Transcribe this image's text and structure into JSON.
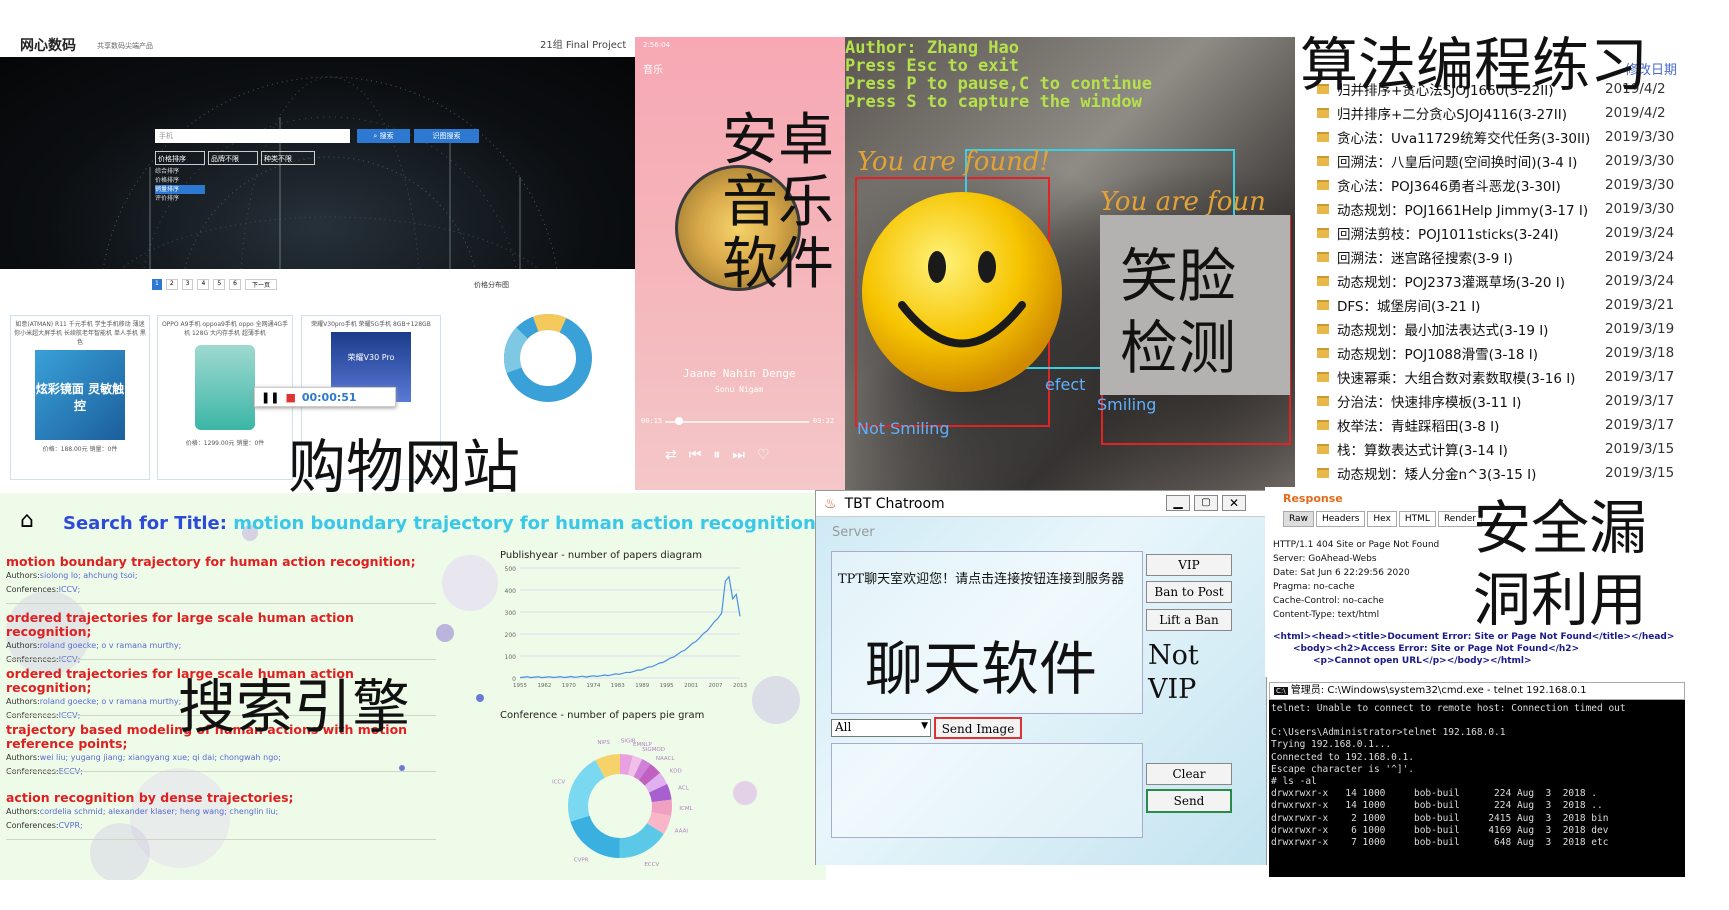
{
  "overlays": {
    "shop": "购物网站",
    "music": [
      "安卓",
      "音乐",
      "软件"
    ],
    "face": [
      "笑脸",
      "检测"
    ],
    "algo": "算法编程练习",
    "search": "搜索引擎",
    "chat": "聊天软件",
    "vuln": [
      "安全漏",
      "洞利用"
    ]
  },
  "shop": {
    "brand": "网心数码",
    "slogan": "共享数码尖端产品",
    "project": "21组 Final Project",
    "search_placeholder": "手机",
    "search_btn": "搜索",
    "voice_btn": "识图搜索",
    "filters": [
      "价格排序",
      "品牌不限",
      "种类不限"
    ],
    "sort_options": [
      "综合排序",
      "价格排序",
      "销量排序",
      "评价排序"
    ],
    "pages": [
      "1",
      "2",
      "3",
      "4",
      "5",
      "6",
      "下一页"
    ],
    "chart_label": "价格分布图",
    "timer": "00:00:51",
    "products": [
      {
        "desc": "如意(ATMAN) R11 千元手机 学生手机移动 薄迷你小米超大屏手机 长续航老年智能机 单人手机 黑色",
        "img": "炫彩镜面 灵敏触控",
        "price": "价格：188.00元  销量：0件"
      },
      {
        "desc": "OPPO A9手机 oppoa9手机 oppo 全网通4G手机 128G 大内存手机 超薄手机",
        "img": "",
        "price": "价格：1299.00元  销量：0件"
      },
      {
        "desc": "荣耀V30pro手机 荣耀5G手机 8GB+128GB",
        "img": "荣耀V30 Pro",
        "price": ""
      }
    ]
  },
  "music": {
    "status_time": "2:56:04",
    "title_label": "音乐",
    "song": "Jaane Nahin Denge",
    "artist": "Sonu Nigam",
    "t_now": "00:15",
    "t_end": "03:22"
  },
  "face": {
    "author": "Author: Zhang Hao",
    "help1": "Press Esc to exit",
    "help2": "Press P to pause,C to continue",
    "help3": "Press S to capture the window",
    "found1": "You are found!",
    "found2": "You are foun",
    "not_smiling": "Not Smiling",
    "smiling": "Smiling",
    "detected": "efect"
  },
  "algo": {
    "header_date": "修改日期",
    "rows": [
      {
        "name": "归并排序+贪心法SJOJ1660(3-22II)",
        "date": "2019/4/2"
      },
      {
        "name": "归并排序+二分贪心SJOJ4116(3-27II)",
        "date": "2019/4/2"
      },
      {
        "name": "贪心法：Uva11729统筹交代任务(3-30II)",
        "date": "2019/3/30"
      },
      {
        "name": "回溯法：八皇后问题(空间换时间)(3-4 I)",
        "date": "2019/3/30"
      },
      {
        "name": "贪心法：POJ3646勇者斗恶龙(3-30I)",
        "date": "2019/3/30"
      },
      {
        "name": "动态规划：POJ1661Help Jimmy(3-17 I)",
        "date": "2019/3/30"
      },
      {
        "name": "回溯法剪枝：POJ1011sticks(3-24I)",
        "date": "2019/3/24"
      },
      {
        "name": "回溯法：迷宫路径搜索(3-9 I)",
        "date": "2019/3/24"
      },
      {
        "name": "动态规划：POJ2373灌溉草场(3-20 I)",
        "date": "2019/3/24"
      },
      {
        "name": "DFS：城堡房间(3-21 I)",
        "date": "2019/3/21"
      },
      {
        "name": "动态规划：最小加法表达式(3-19 I)",
        "date": "2019/3/19"
      },
      {
        "name": "动态规划：POJ1088滑雪(3-18 I)",
        "date": "2019/3/18"
      },
      {
        "name": "快速幂乘：大组合数对素数取模(3-16 I)",
        "date": "2019/3/17"
      },
      {
        "name": "分治法：快速排序模板(3-11 I)",
        "date": "2019/3/17"
      },
      {
        "name": "枚举法：青蛙踩稻田(3-8 I)",
        "date": "2019/3/17"
      },
      {
        "name": "栈：算数表达式计算(3-14 I)",
        "date": "2019/3/15"
      },
      {
        "name": "动态规划：矮人分金n^3(3-15 I)",
        "date": "2019/3/15"
      }
    ]
  },
  "search": {
    "prefix": "Search for Title: ",
    "query": "motion boundary trajectory for human action recognition",
    "results": [
      {
        "title": "motion boundary trajectory for human action recognition;",
        "authors": "siolong lo; ahchung tsoi;",
        "conf": "ICCV;"
      },
      {
        "title": "ordered trajectories for large scale human action recognition;",
        "authors": "roland goecke; o v ramana murthy;",
        "conf": "ICCV;"
      },
      {
        "title": "ordered trajectories for large scale human action recognition;",
        "authors": "roland goecke; o v ramana murthy;",
        "conf": "ICCV;"
      },
      {
        "title": "trajectory based modeling of human actions with motion reference points;",
        "authors": "wei liu; yugang jiang; xiangyang xue; qi dai; chongwah ngo;",
        "conf": "ECCV;"
      },
      {
        "title": "action recognition by dense trajectories;",
        "authors": "cordelia schmid; alexander klaser; heng wang; chenglin liu;",
        "conf": "CVPR;"
      }
    ],
    "authors_label": "Authors:",
    "conf_label": "Conferences:",
    "chart1_title": "Publishyear - number of papers diagram",
    "chart2_title": "Conference - number of papers pie gram",
    "chart1_yticks": [
      "500",
      "400",
      "300",
      "200",
      "100",
      "0"
    ],
    "chart1_xticks": [
      "1955",
      "1962",
      "1970",
      "1974",
      "1983",
      "1989",
      "1995",
      "2001",
      "2007",
      "2013"
    ],
    "pie_labels": [
      "SIGIR",
      "EMNLP",
      "SIGMOD",
      "NAACL",
      "KDD",
      "ACL",
      "ICML",
      "AAAI",
      "ECCV",
      "CVPR",
      "ICCV",
      "NIPS"
    ]
  },
  "chat": {
    "title": "TBT Chatroom",
    "server_label": "Server",
    "welcome": "TPT聊天室欢迎您！请点击连接按钮连接到服务器",
    "buttons": [
      "VIP",
      "Ban to Post",
      "Lift a Ban"
    ],
    "status": [
      "Not",
      "VIP"
    ],
    "select_value": "All",
    "send_image": "Send Image",
    "clear": "Clear",
    "send": "Send"
  },
  "vuln": {
    "response_label": "Response",
    "tabs": [
      "Raw",
      "Headers",
      "Hex",
      "HTML",
      "Render"
    ],
    "http_lines": [
      "HTTP/1.1 404 Site or Page Not Found",
      "Server: GoAhead-Webs",
      "Date: Sat Jun  6 22:29:56 2020",
      "Pragma: no-cache",
      "Cache-Control: no-cache",
      "Content-Type: text/html"
    ],
    "html_lines": [
      "<html><head><title>Document Error: Site or Page Not Found</title></head>",
      "<body><h2>Access Error: Site or Page Not Found</h2>",
      "<p>Cannot open URL</p></body></html>"
    ],
    "cmd_title": "管理员: C:\\Windows\\system32\\cmd.exe - telnet  192.168.0.1",
    "cmd_lines": [
      "telnet: Unable to connect to remote host: Connection timed out",
      "",
      "C:\\Users\\Administrator>telnet 192.168.0.1",
      "Trying 192.168.0.1...",
      "Connected to 192.168.0.1.",
      "Escape character is '^]'.",
      "# ls -al",
      "drwxrwxr-x   14 1000     bob-buil      224 Aug  3  2018 .",
      "drwxrwxr-x   14 1000     bob-buil      224 Aug  3  2018 ..",
      "drwxrwxr-x    2 1000     bob-buil     2415 Aug  3  2018 bin",
      "drwxrwxr-x    6 1000     bob-buil     4169 Aug  3  2018 dev",
      "drwxrwxr-x    7 1000     bob-buil      648 Aug  3  2018 etc"
    ]
  }
}
